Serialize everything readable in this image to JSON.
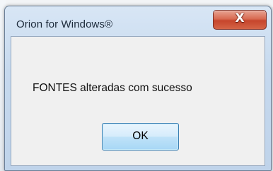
{
  "dialog": {
    "title": "Orion for Windows®",
    "close_label": "X",
    "message": "FONTES alteradas com sucesso",
    "ok_label": "OK"
  }
}
